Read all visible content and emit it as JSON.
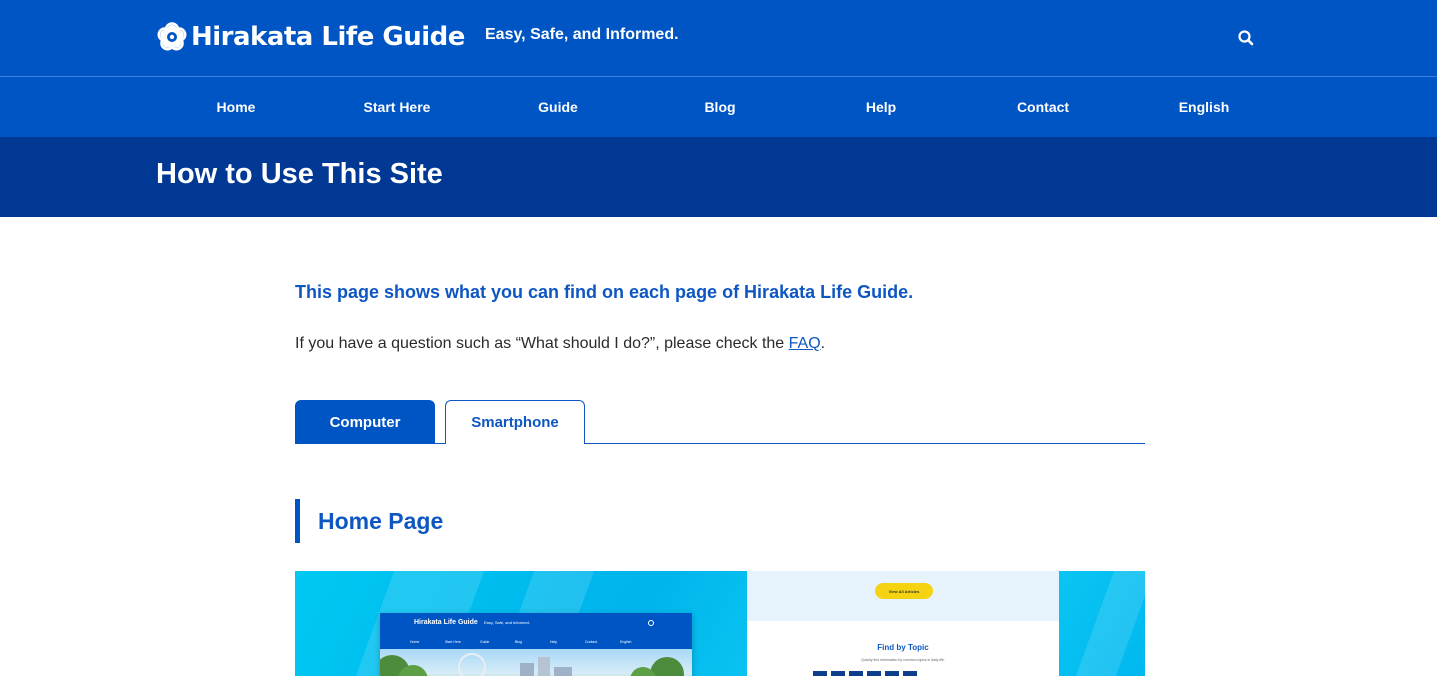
{
  "header": {
    "logo_text": "Hirakata Life Guide",
    "tagline": "Easy, Safe, and Informed.",
    "search_icon": "search-icon"
  },
  "nav": {
    "items": [
      "Home",
      "Start Here",
      "Guide",
      "Blog",
      "Help",
      "Contact",
      "English"
    ]
  },
  "page": {
    "title": "How to Use This Site",
    "lead": "This page shows what you can find on each page of Hirakata Life Guide.",
    "para_before": "If you have a question such as “What should I do?”, please check the ",
    "para_link": "FAQ",
    "para_after": "."
  },
  "tabs": {
    "active": "Computer",
    "inactive": "Smartphone"
  },
  "section": {
    "heading": "Home Page"
  },
  "preview": {
    "mini_logo": "Hirakata Life Guide",
    "mini_tagline": "Easy, Safe, and Informed.",
    "mini_nav": [
      "Home",
      "Start Here",
      "Guide",
      "Blog",
      "Help",
      "Contact",
      "English"
    ],
    "button_label": "View All Articles",
    "topic_title": "Find by Topic",
    "topic_sub": "Quickly find information by common topics in daily life."
  },
  "colors": {
    "brand_blue": "#0055c4",
    "title_bar": "#003894",
    "link_blue": "#0e57c2",
    "accent_yellow": "#f5d312"
  }
}
